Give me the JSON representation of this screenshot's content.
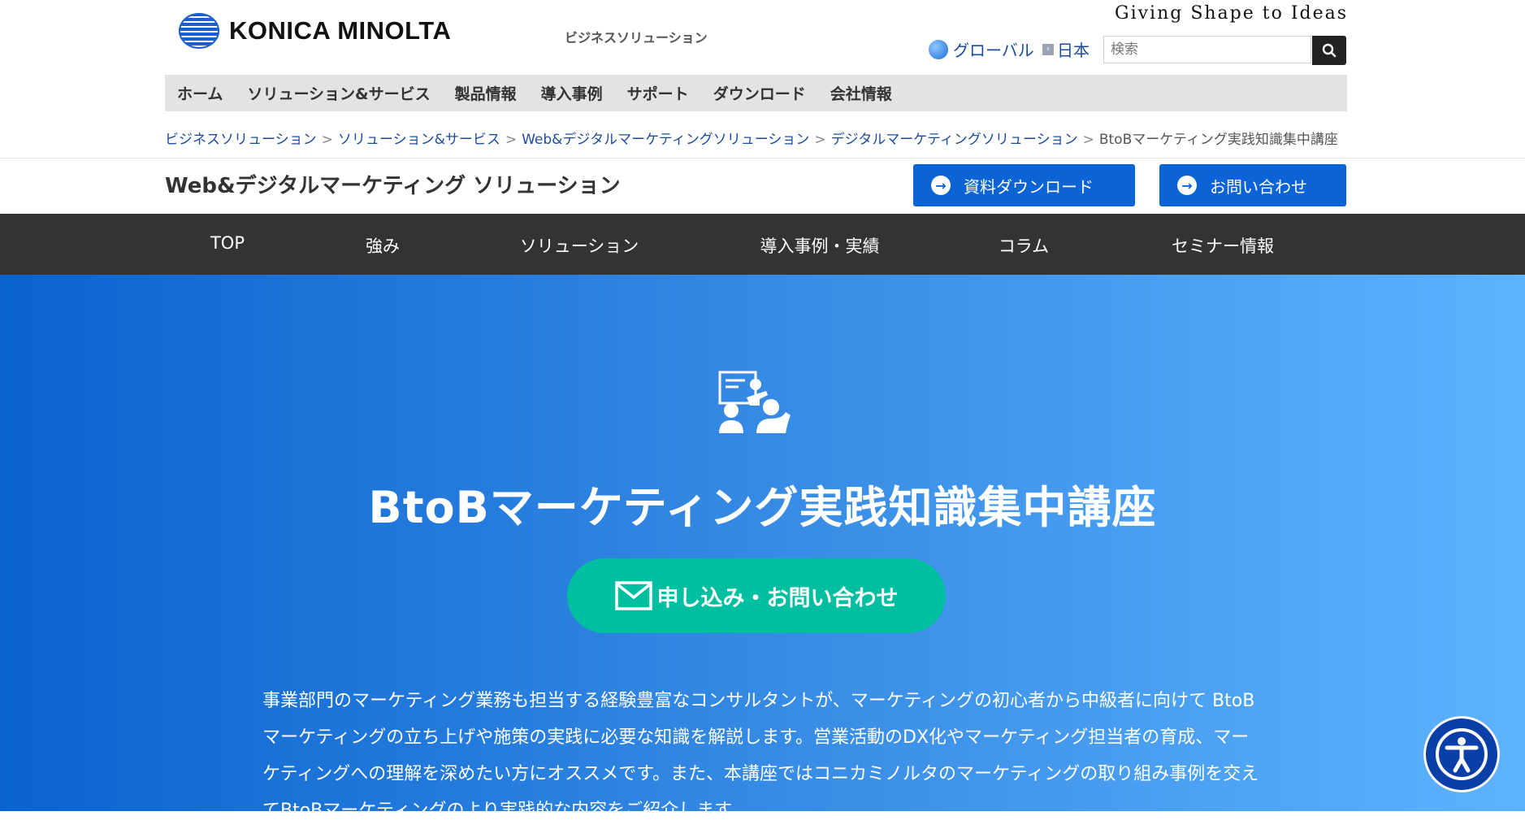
{
  "header": {
    "logo_text": "KONICA MINOLTA",
    "business_label": "ビジネスソリューション",
    "tagline": "Giving Shape to Ideas",
    "lang_global": "グローバル",
    "lang_japan": "日本",
    "search_placeholder": "検索"
  },
  "main_nav": [
    "ホーム",
    "ソリューション&サービス",
    "製品情報",
    "導入事例",
    "サポート",
    "ダウンロード",
    "会社情報"
  ],
  "breadcrumb": {
    "items": [
      "ビジネスソリューション",
      "ソリューション&サービス",
      "Web&デジタルマーケティングソリューション",
      "デジタルマーケティングソリューション"
    ],
    "separator": ">",
    "current": "BtoBマーケティング実践知識集中講座"
  },
  "subheader": {
    "title": "Web&デジタルマーケティング ソリューション",
    "download_button": "資料ダウンロード",
    "contact_button": "お問い合わせ"
  },
  "section_nav": [
    "TOP",
    "強み",
    "ソリューション",
    "導入事例・実績",
    "コラム",
    "セミナー情報"
  ],
  "hero": {
    "title": "BtoBマーケティング実践知識集中講座",
    "cta_label": "申し込み・お問い合わせ",
    "description": "事業部門のマーケティング業務も担当する経験豊富なコンサルタントが、マーケティングの初心者から中級者に向けて BtoBマーケティングの立ち上げや施策の実践に必要な知識を解説します。営業活動のDX化やマーケティング担当者の育成、マーケティングへの理解を深めたい方にオススメです。また、本講座ではコニカミノルタのマーケティングの取り組み事例を交えてBtoBマーケティングのより実践的な内容をご紹介します。"
  },
  "icons": {
    "logo": "konica-minolta-globe-logo",
    "globe": "globe-icon",
    "search": "search-icon",
    "arrow": "arrow-right-circle-icon",
    "seminar": "seminar-teacher-icon",
    "mail": "mail-icon",
    "accessibility": "accessibility-icon"
  },
  "colors": {
    "primary_blue": "#0b63d6",
    "cta_green": "#00bfa0",
    "dark_nav": "#333333",
    "hero_gradient_start": "#0a63cf",
    "hero_gradient_end": "#5db3ff"
  }
}
